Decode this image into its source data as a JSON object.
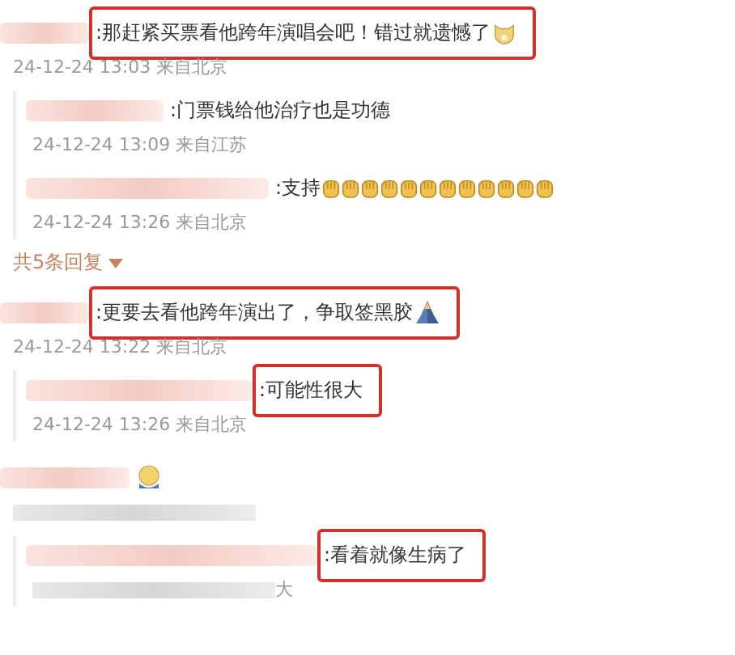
{
  "comments": [
    {
      "kind": "doge",
      "text": ":那赶紧买票看他跨年演唱会吧！错过就遗憾了",
      "highlighted": true,
      "time": "24-12-24 13:03 来自北京",
      "replies": [
        {
          "kind": "plain",
          "text": ":门票钱给他治疗也是功德",
          "highlighted": false,
          "time": "24-12-24 13:09 来自江苏"
        },
        {
          "kind": "fists",
          "text": ":支持",
          "highlighted": false,
          "time": "24-12-24 13:26 来自北京"
        }
      ],
      "more": "共5条回复"
    },
    {
      "kind": "pray",
      "text": ":更要去看他跨年演出了，争取签黑胶",
      "highlighted": true,
      "time": "24-12-24 13:22 来自北京",
      "replies": [
        {
          "kind": "plain",
          "text": ":可能性很大",
          "highlighted": true,
          "time": "24-12-24 13:26 来自北京"
        }
      ]
    },
    {
      "kind": "sick",
      "highlighted": false,
      "replies": [
        {
          "kind": "plain",
          "text": ":看着就像生病了",
          "highlighted": true,
          "time_fragment": "大"
        }
      ]
    }
  ]
}
